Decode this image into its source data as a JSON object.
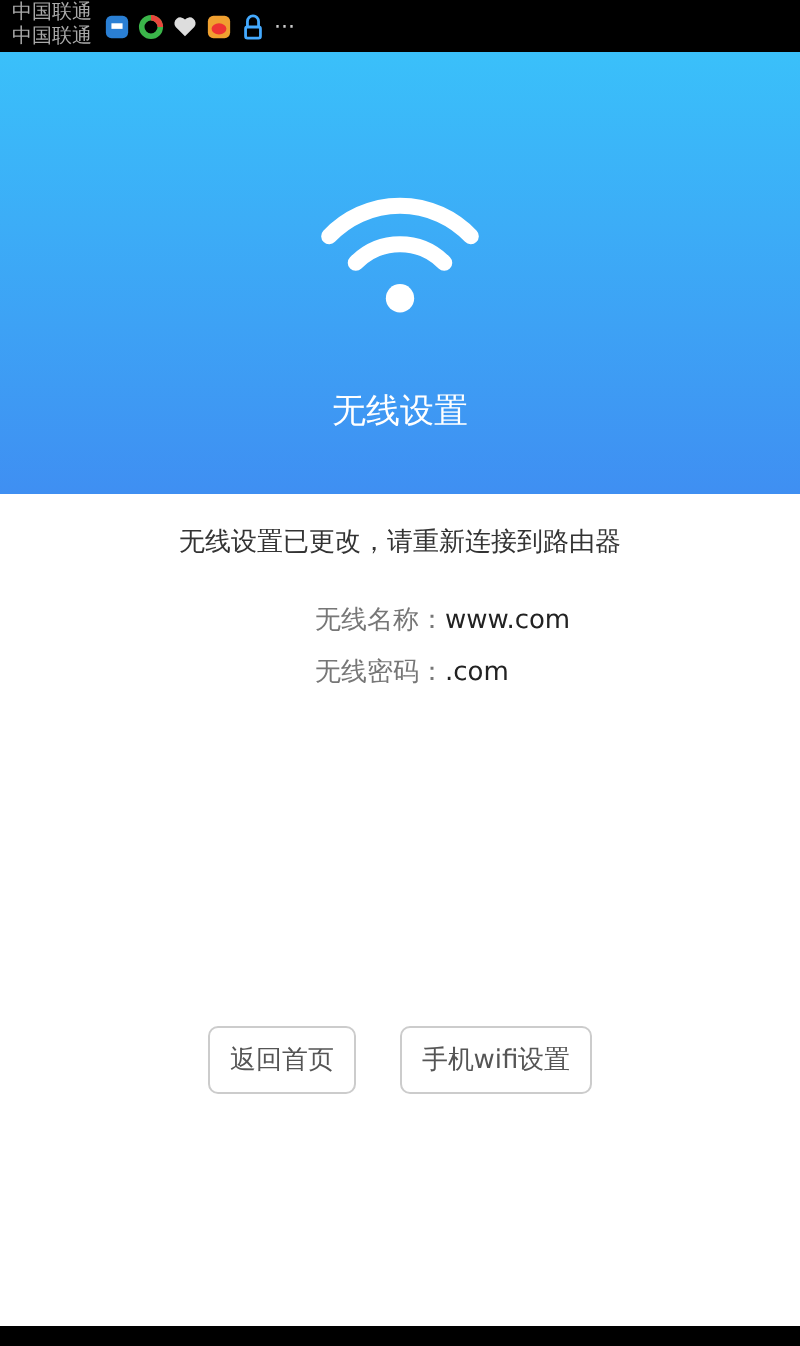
{
  "status_bar": {
    "carriers": [
      "中国联通",
      "中国联通"
    ],
    "more": "···"
  },
  "header": {
    "title": "无线设置"
  },
  "message": "无线设置已更改，请重新连接到路由器",
  "info": [
    {
      "label": "无线名称：",
      "value": "www.com"
    },
    {
      "label": "无线密码：",
      "value": ".com"
    }
  ],
  "buttons": [
    "返回首页",
    "手机wifi设置"
  ]
}
